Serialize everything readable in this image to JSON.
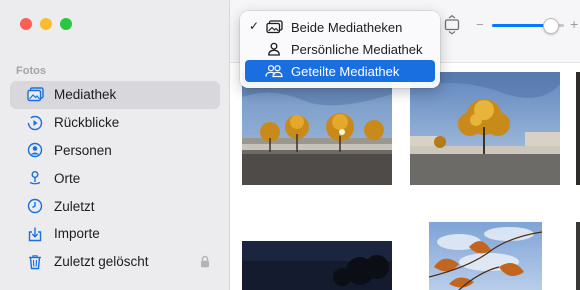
{
  "window": {
    "traffic_lights": {
      "close": "#ff5f57",
      "minimize": "#febc2e",
      "zoom": "#28c840"
    }
  },
  "sidebar": {
    "section_label": "Fotos",
    "items": [
      {
        "label": "Mediathek",
        "icon": "photo-library-icon",
        "selected": true
      },
      {
        "label": "Rückblicke",
        "icon": "memories-icon"
      },
      {
        "label": "Personen",
        "icon": "people-icon"
      },
      {
        "label": "Orte",
        "icon": "places-pin-icon"
      },
      {
        "label": "Zuletzt",
        "icon": "clock-icon"
      },
      {
        "label": "Importe",
        "icon": "import-icon"
      },
      {
        "label": "Zuletzt gelöscht",
        "icon": "trash-icon",
        "locked": true
      }
    ]
  },
  "library_menu": {
    "items": [
      {
        "label": "Beide Mediatheken",
        "checked": true,
        "icon": "photos-stack-icon"
      },
      {
        "label": "Persönliche Mediathek",
        "checked": false,
        "icon": "person-icon"
      },
      {
        "label": "Geteilte Mediathek",
        "checked": false,
        "icon": "shared-people-icon",
        "highlighted": true
      }
    ]
  },
  "toolbar": {
    "zoom_minus": "−",
    "zoom_plus": "+",
    "zoom_level": 0.8
  },
  "colors": {
    "accent": "#1a6fe0",
    "sidebar_bg": "#ececef",
    "selected_row": "#d8d8dc"
  }
}
